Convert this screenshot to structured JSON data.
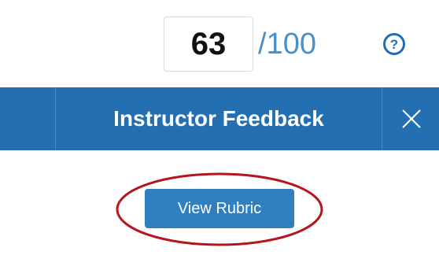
{
  "score": {
    "value": "63",
    "total": "/100",
    "help_icon": "question-circle-icon",
    "help_glyph": "?"
  },
  "feedback_panel": {
    "title": "Instructor Feedback",
    "close_icon": "close-icon"
  },
  "rubric": {
    "button_label": "View Rubric"
  },
  "colors": {
    "bar_background": "#236fb1",
    "button_background": "#2f7fc1",
    "score_total": "#4a90c8",
    "highlight_ring": "#b5161b"
  }
}
